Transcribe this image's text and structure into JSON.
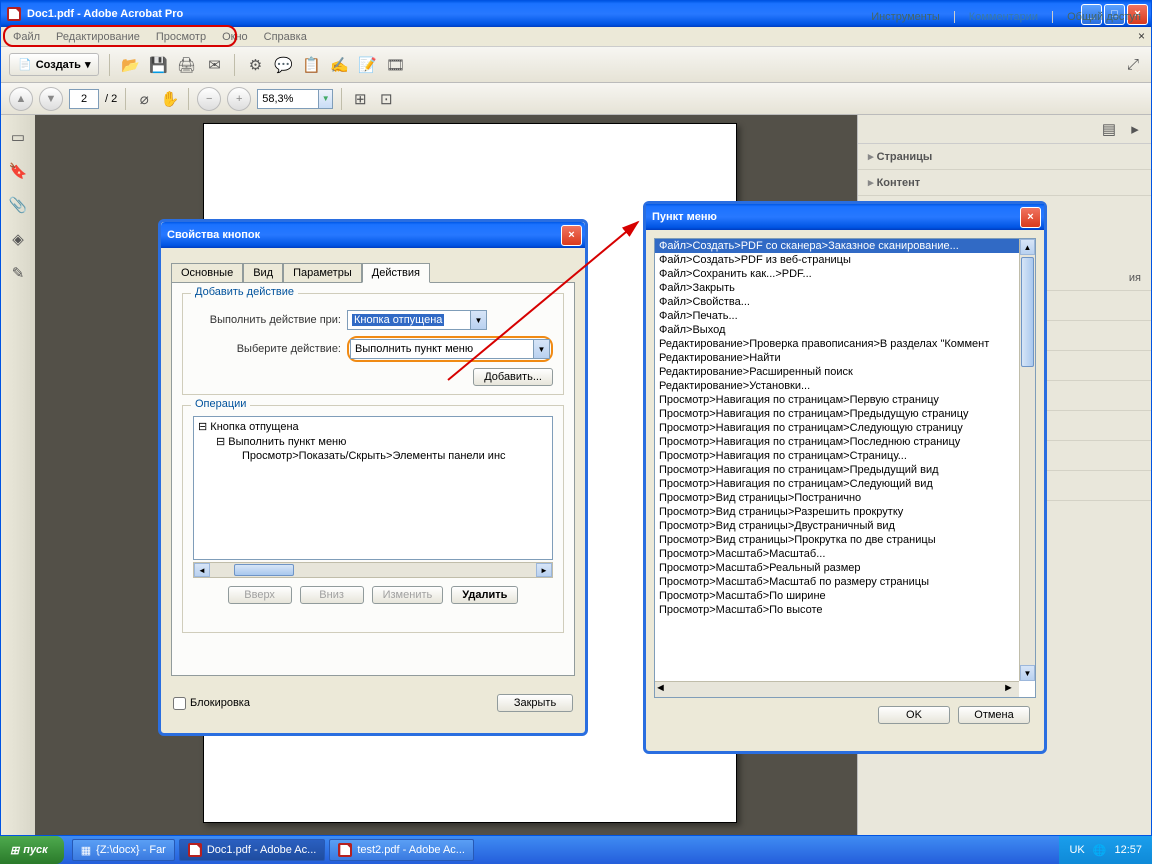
{
  "app": {
    "title": "Doc1.pdf - Adobe Acrobat Pro"
  },
  "menu": {
    "file": "Файл",
    "edit": "Редактирование",
    "view": "Просмотр",
    "window": "Окно",
    "help": "Справка"
  },
  "toolbar": {
    "create": "Создать"
  },
  "nav": {
    "page": "2",
    "total": "/  2",
    "zoom": "58,3%"
  },
  "rightTabs": {
    "tools": "Инструменты",
    "comments": "Комментарии",
    "share": "Общий доступ"
  },
  "rightPane": {
    "pages": "Страницы",
    "content": "Контент",
    "collapsed": "ия"
  },
  "dlg1": {
    "title": "Свойства кнопок",
    "tabs": {
      "main": "Основные",
      "view": "Вид",
      "params": "Параметры",
      "actions": "Действия"
    },
    "addAction": "Добавить действие",
    "triggerLabel": "Выполнить действие при:",
    "triggerValue": "Кнопка отпущена",
    "actionLabel": "Выберите действие:",
    "actionValue": "Выполнить пункт меню",
    "addBtn": "Добавить...",
    "opsLegend": "Операции",
    "root": "Кнопка отпущена",
    "child1": "Выполнить пункт меню",
    "child2": "Просмотр>Показать/Скрыть>Элементы панели инс",
    "up": "Вверх",
    "down": "Вниз",
    "editBtn": "Изменить",
    "delBtn": "Удалить",
    "lock": "Блокировка",
    "closeBtn": "Закрыть"
  },
  "dlg2": {
    "title": "Пункт меню",
    "items": [
      "Файл>Создать>PDF со сканера>Заказное сканирование...",
      "Файл>Создать>PDF из веб-страницы",
      "Файл>Сохранить как...>PDF...",
      "Файл>Закрыть",
      "Файл>Свойства...",
      "Файл>Печать...",
      "Файл>Выход",
      "Редактирование>Проверка правописания>В разделах \"Коммент",
      "Редактирование>Найти",
      "Редактирование>Расширенный поиск",
      "Редактирование>Установки...",
      "Просмотр>Навигация по страницам>Первую страницу",
      "Просмотр>Навигация по страницам>Предыдущую страницу",
      "Просмотр>Навигация по страницам>Следующую страницу",
      "Просмотр>Навигация по страницам>Последнюю страницу",
      "Просмотр>Навигация по страницам>Страницу...",
      "Просмотр>Навигация по страницам>Предыдущий вид",
      "Просмотр>Навигация по страницам>Следующий вид",
      "Просмотр>Вид страницы>Постранично",
      "Просмотр>Вид страницы>Разрешить прокрутку",
      "Просмотр>Вид страницы>Двустраничный вид",
      "Просмотр>Вид страницы>Прокрутка по две страницы",
      "Просмотр>Масштаб>Масштаб...",
      "Просмотр>Масштаб>Реальный размер",
      "Просмотр>Масштаб>Масштаб по размеру страницы",
      "Просмотр>Масштаб>По ширине",
      "Просмотр>Масштаб>По высоте"
    ],
    "ok": "OK",
    "cancel": "Отмена"
  },
  "taskbar": {
    "start": "пуск",
    "t1": "{Z:\\docx} - Far",
    "t2": "Doc1.pdf - Adobe Ac...",
    "t3": "test2.pdf - Adobe Ac...",
    "lang": "UK",
    "time": "12:57"
  }
}
